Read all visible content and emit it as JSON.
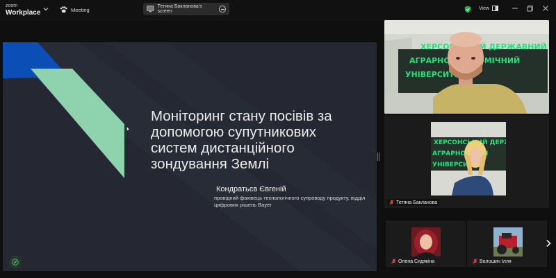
{
  "app": {
    "brand_small": "zoom",
    "brand_large": "Workplace",
    "meeting_label": "Meeting",
    "share_label": "Тетяна Бакланова's screen",
    "view_label": "View"
  },
  "slide": {
    "title": "Моніторинг стану посівів за допомогою супутникових систем дистанційного зондування Землі",
    "author": "Кондратьєв Євгеній",
    "role": "провідний фахівець технологічного супроводу продукту, відділ цифрових рішень Bayer"
  },
  "participants": {
    "speaker": {
      "bg_text_1": "ХЕРСОНСЬКИЙ ДЕРЖАВНИЙ",
      "bg_text_2": "АГРАРНО-ЕКОНОМІЧНИЙ",
      "bg_text_3": "УНІВЕРСИТЕТ"
    },
    "second": {
      "name": "Тетяна Бакланова",
      "bg_text_1": "ХЕРСОНСЬКИЙ ДЕРЖ",
      "bg_text_2": "АГРАРНО-ЕКОН",
      "bg_text_3": "УНІВЕРСИТЕТ"
    },
    "thumbs": [
      {
        "name": "Олена Сидякіна"
      },
      {
        "name": "Волошин Ілля"
      }
    ]
  },
  "colors": {
    "slide_bg": "#252832",
    "blue_shape": "#0b4fb6",
    "mint_shape": "#8fd3ae",
    "wall_green": "#1ee37b",
    "shield_green": "#22b24c"
  }
}
